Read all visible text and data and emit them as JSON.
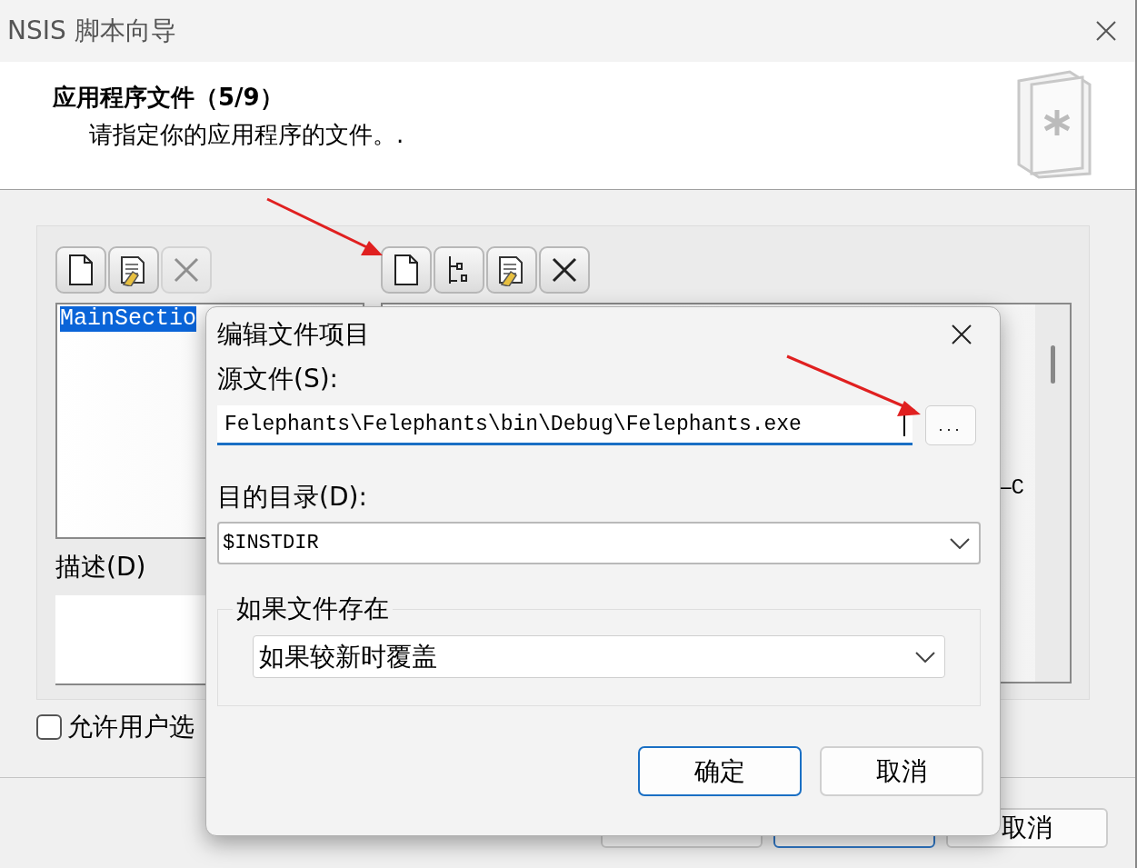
{
  "window": {
    "title": "NSIS 脚本向导"
  },
  "header": {
    "title": "应用程序文件（5/9）",
    "subtitle": "请指定你的应用程序的文件。."
  },
  "left_toolbar": [
    {
      "kind": "new",
      "disabled": false
    },
    {
      "kind": "edit",
      "disabled": false
    },
    {
      "kind": "delete",
      "disabled": true
    }
  ],
  "right_toolbar": [
    {
      "kind": "new",
      "disabled": false
    },
    {
      "kind": "tree",
      "disabled": false
    },
    {
      "kind": "edit",
      "disabled": false
    },
    {
      "kind": "delete",
      "disabled": false
    }
  ],
  "sections": [
    {
      "label": "MainSectio",
      "selected": true
    }
  ],
  "description_label": "描述(D)",
  "file_tree_fragment": "—C",
  "allow_user_checkbox": {
    "label": "允许用户选",
    "checked": false
  },
  "bottom_buttons": [
    {
      "default": false
    },
    {
      "default": true
    },
    {
      "label": "取消",
      "default": false
    }
  ],
  "dialog": {
    "title": "编辑文件项目",
    "source_label": "源文件(S):",
    "source_value": "Felephants\\Felephants\\bin\\Debug\\Felephants.exe",
    "browse_button": "...",
    "target_label": "目的目录(D):",
    "target_value": "$INSTDIR",
    "exists_group": "如果文件存在",
    "exists_option": "如果较新时覆盖",
    "buttons": [
      {
        "label": "确定",
        "default": true
      },
      {
        "label": "取消",
        "default": false
      }
    ]
  },
  "annotations": [
    {
      "kind": "arrow"
    },
    {
      "kind": "arrow"
    }
  ]
}
